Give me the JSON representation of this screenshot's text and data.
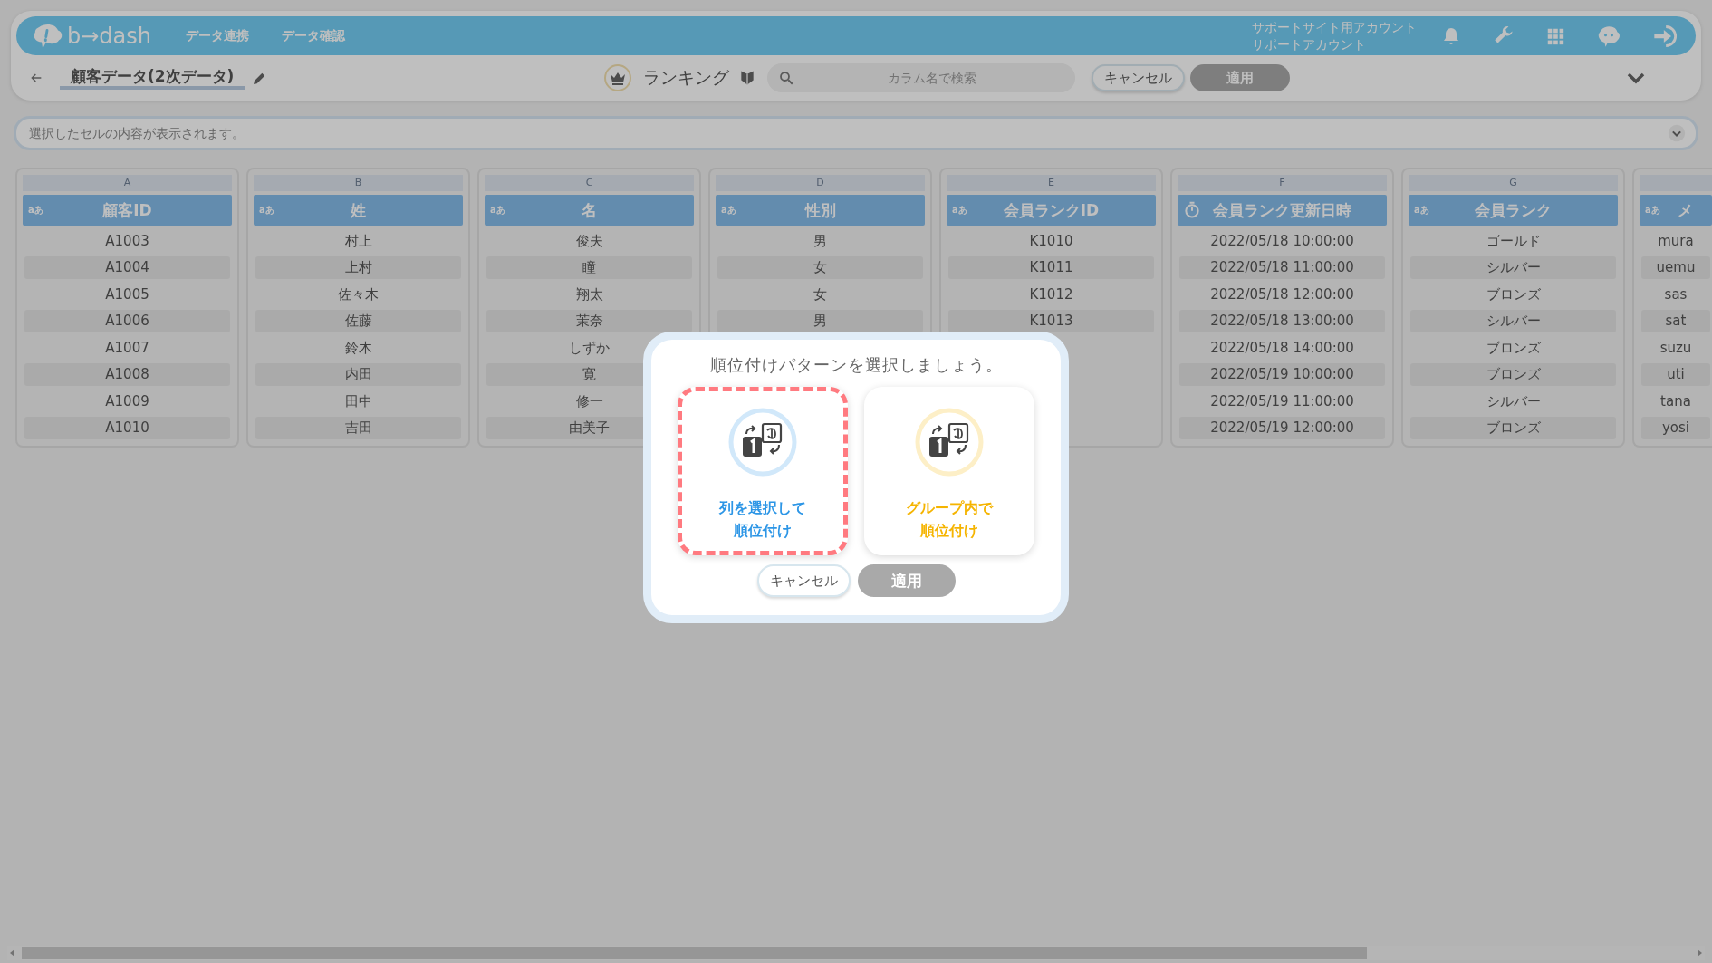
{
  "header": {
    "logo_text": "b→dash",
    "nav": [
      {
        "label": "データ連携"
      },
      {
        "label": "データ確認"
      }
    ],
    "account": {
      "site": "サポートサイト用アカウント",
      "name": "サポートアカウント"
    }
  },
  "toolbar": {
    "title": "顧客データ(2次データ)",
    "mode": "ランキング",
    "search": {
      "placeholder": "カラム名で検索"
    },
    "buttons": [
      {
        "label": "キャンセル",
        "disabled": false
      },
      {
        "label": "適用",
        "disabled": true
      }
    ]
  },
  "cell_bar": {
    "placeholder": "選択したセルの内容が表示されます。"
  },
  "table": {
    "columns": [
      {
        "letter": "A",
        "kind": "text",
        "type_label": "aあ",
        "title": "顧客ID",
        "cells": [
          "A1003",
          "A1004",
          "A1005",
          "A1006",
          "A1007",
          "A1008",
          "A1009",
          "A1010"
        ]
      },
      {
        "letter": "B",
        "kind": "text",
        "type_label": "aあ",
        "title": "姓",
        "cells": [
          "村上",
          "上村",
          "佐々木",
          "佐藤",
          "鈴木",
          "内田",
          "田中",
          "吉田"
        ]
      },
      {
        "letter": "C",
        "kind": "text",
        "type_label": "aあ",
        "title": "名",
        "cells": [
          "俊夫",
          "瞳",
          "翔太",
          "茉奈",
          "しずか",
          "寛",
          "修一",
          "由美子"
        ]
      },
      {
        "letter": "D",
        "kind": "text",
        "type_label": "aあ",
        "title": "性別",
        "cells": [
          "男",
          "女",
          "女",
          "男"
        ]
      },
      {
        "letter": "E",
        "kind": "text",
        "type_label": "aあ",
        "title": "会員ランクID",
        "cells": [
          "K1010",
          "K1011",
          "K1012",
          "K1013"
        ]
      },
      {
        "letter": "F",
        "kind": "datetime",
        "title": "会員ランク更新日時",
        "cells": [
          "2022/05/18 10:00:00",
          "2022/05/18 11:00:00",
          "2022/05/18 12:00:00",
          "2022/05/18 13:00:00",
          "2022/05/18 14:00:00",
          "2022/05/19 10:00:00",
          "2022/05/19 11:00:00",
          "2022/05/19 12:00:00"
        ]
      },
      {
        "letter": "G",
        "kind": "text",
        "type_label": "aあ",
        "title": "会員ランク",
        "cells": [
          "ゴールド",
          "シルバー",
          "ブロンズ",
          "シルバー",
          "ブロンズ",
          "ブロンズ",
          "シルバー",
          "ブロンズ"
        ]
      },
      {
        "kind": "text",
        "type_label": "aあ",
        "title": "メ",
        "cells": [
          "mura",
          "uemu",
          "sas",
          "sat",
          "suzu",
          "uti",
          "tana",
          "yosi"
        ]
      }
    ]
  },
  "dialog": {
    "title": "順位付けパターンを選択しましょう。",
    "options": [
      {
        "lines": [
          "列を選択して",
          "順位付け"
        ],
        "color": "#2d96e6",
        "selected": true
      },
      {
        "lines": [
          "グループ内で",
          "順位付け"
        ],
        "color": "#f5b400",
        "selected": false
      }
    ],
    "buttons": [
      {
        "label": "キャンセル",
        "disabled": false
      },
      {
        "label": "適用",
        "disabled": true
      }
    ]
  }
}
